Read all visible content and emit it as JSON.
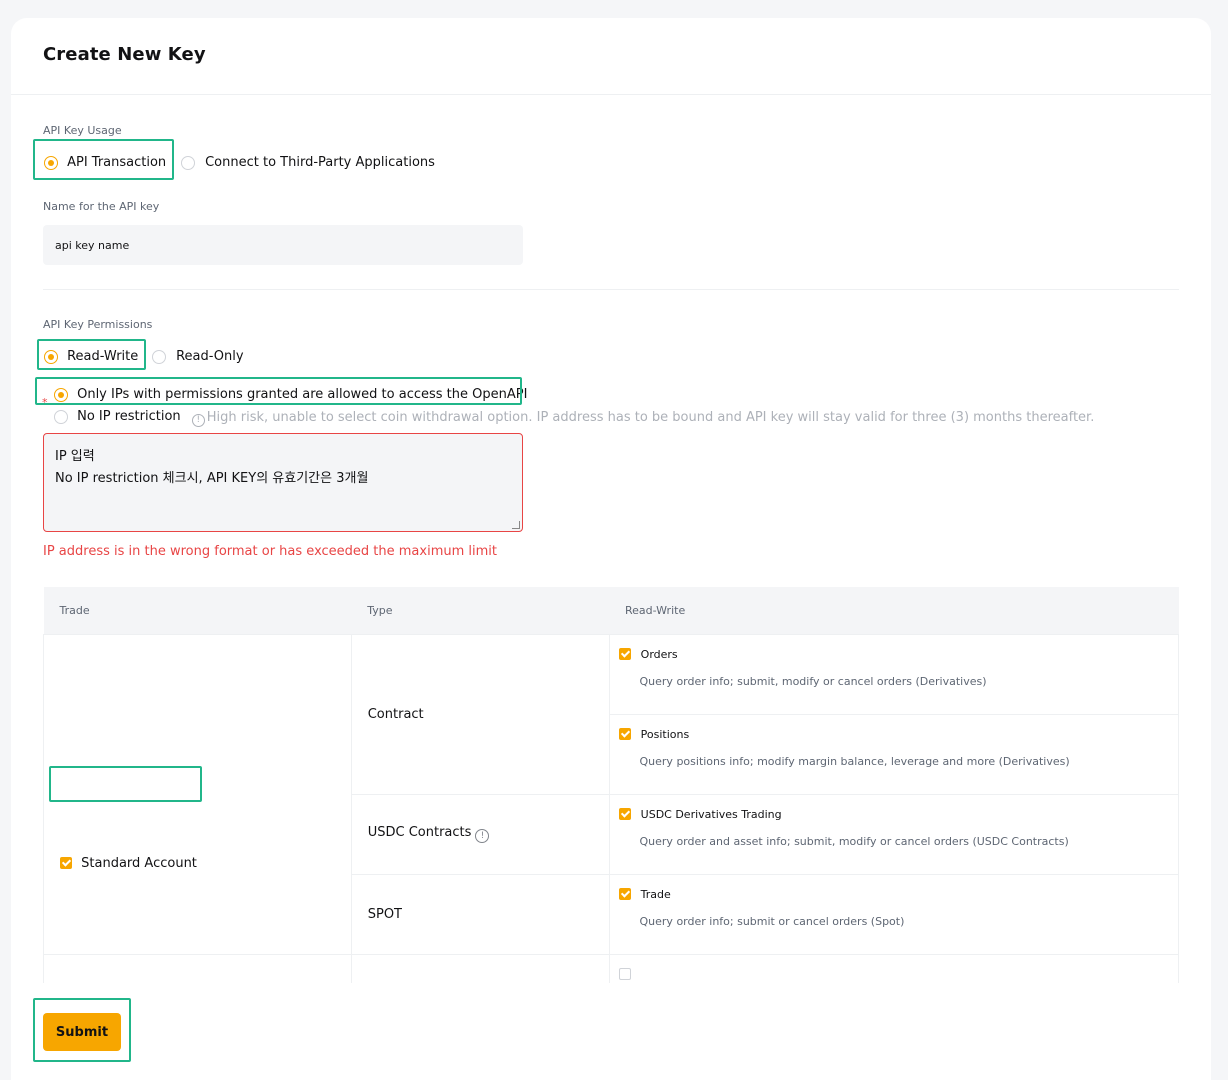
{
  "page": {
    "title": "Create New Key"
  },
  "usage": {
    "label": "API Key Usage",
    "options": [
      {
        "label": "API Transaction",
        "selected": true
      },
      {
        "label": "Connect to Third-Party Applications",
        "selected": false
      }
    ]
  },
  "name_field": {
    "label": "Name for the API key",
    "value": "api key name"
  },
  "permissions": {
    "label": "API Key Permissions",
    "options": [
      {
        "label": "Read-Write",
        "selected": true
      },
      {
        "label": "Read-Only",
        "selected": false
      }
    ]
  },
  "ip": {
    "required_mark": "*",
    "restricted_label": "Only IPs with permissions granted are allowed to access the OpenAPI",
    "unrestricted_label": "No IP restriction",
    "unrestricted_hint_icon": "!",
    "unrestricted_hint": "High risk, unable to select coin withdrawal option. IP address has to be bound and API key will stay valid for three (3) months thereafter.",
    "textarea_line1": "IP 입력",
    "textarea_line2": "No IP restriction 체크시, API KEY의 유효기간은 3개월",
    "error": "IP address is in the wrong format or has exceeded the maximum limit"
  },
  "table": {
    "headers": [
      "Trade",
      "Type",
      "Read-Write"
    ],
    "account_label": "Standard Account",
    "types": {
      "contract": "Contract",
      "usdc": "USDC Contracts",
      "usdc_info": "!",
      "spot": "SPOT"
    },
    "perms": {
      "orders": {
        "name": "Orders",
        "desc": "Query order info; submit, modify or cancel orders (Derivatives)"
      },
      "positions": {
        "name": "Positions",
        "desc": "Query positions info; modify margin balance, leverage and more (Derivatives)"
      },
      "usdc_trading": {
        "name": "USDC Derivatives Trading",
        "desc": "Query order and asset info; submit, modify or cancel orders (USDC Contracts)"
      },
      "spot_trade": {
        "name": "Trade",
        "desc": "Query order info; submit or cancel orders (Spot)"
      }
    }
  },
  "actions": {
    "submit_label": "Submit"
  },
  "colors": {
    "accent": "#f7a600",
    "highlight": "#21b68a",
    "error": "#e84545"
  }
}
